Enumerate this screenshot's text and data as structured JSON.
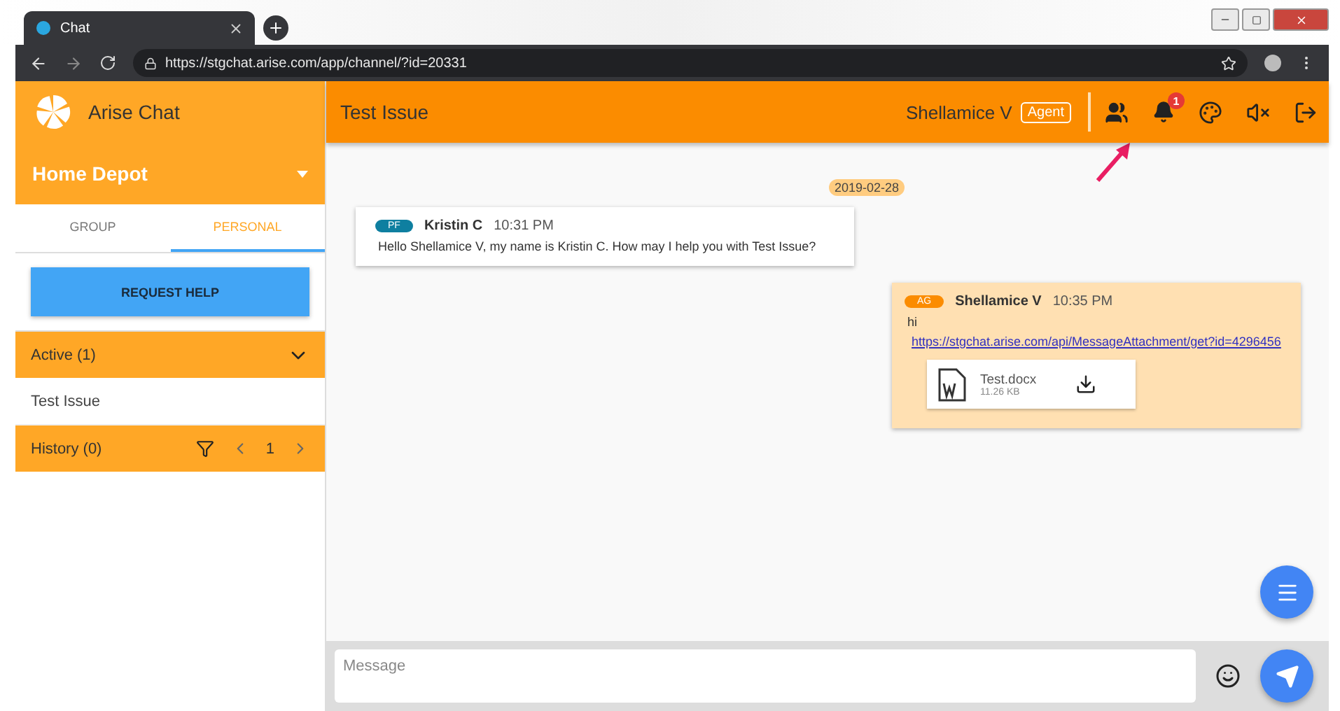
{
  "browser": {
    "tab_title": "Chat",
    "url": "https://stgchat.arise.com/app/channel/?id=20331"
  },
  "sidebar": {
    "app_name": "Arise Chat",
    "account": "Home Depot",
    "tabs": [
      {
        "label": "GROUP",
        "selected": false
      },
      {
        "label": "PERSONAL",
        "selected": true
      }
    ],
    "request_button": "REQUEST HELP",
    "active": {
      "title": "Active (1)",
      "expanded": true,
      "items": [
        "Test Issue"
      ]
    },
    "history": {
      "title": "History (0)",
      "page": "1"
    }
  },
  "header": {
    "title": "Test Issue",
    "user": "Shellamice V",
    "role": "Agent",
    "notification_count": "1"
  },
  "chat": {
    "date": "2019-02-28",
    "messages": [
      {
        "kind": "incoming",
        "initials": "PF",
        "sender": "Kristin C",
        "time": "10:31 PM",
        "text": "Hello Shellamice V, my name is Kristin C. How may I help you with Test Issue?"
      },
      {
        "kind": "outgoing",
        "initials": "AG",
        "sender": "Shellamice V",
        "time": "10:35 PM",
        "text": "hi",
        "link": "https://stgchat.arise.com/api/MessageAttachment/get?id=4296456",
        "attachment": {
          "name": "Test.docx",
          "size": "11.26 KB"
        }
      }
    ]
  },
  "composer": {
    "placeholder": "Message"
  }
}
